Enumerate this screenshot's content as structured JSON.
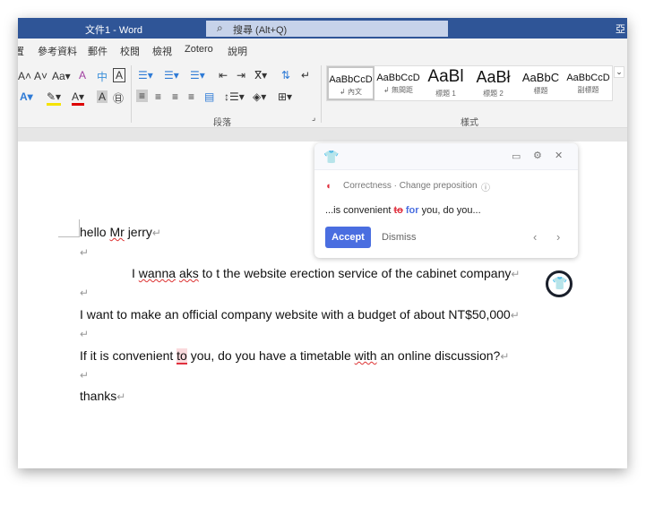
{
  "titlebar": {
    "title": "文件1  -  Word",
    "search_placeholder": "搜尋 (Alt+Q)",
    "right_char": "亞"
  },
  "menu": [
    "置",
    "參考資料",
    "郵件",
    "校閱",
    "檢視",
    "Zotero",
    "說明"
  ],
  "ribbon": {
    "paragraph_group": "段落",
    "styles_group": "樣式",
    "styles": [
      {
        "preview": "AaBbCcD",
        "label": "↲ 內文"
      },
      {
        "preview": "AaBbCcD",
        "label": "↲ 無間距"
      },
      {
        "preview": "AaBl",
        "label": "標題 1"
      },
      {
        "preview": "AaBł",
        "label": "標題 2"
      },
      {
        "preview": "AaBbC",
        "label": "標題"
      },
      {
        "preview": "AaBbCcD",
        "label": "副標題"
      }
    ]
  },
  "document": {
    "line1a": "hello ",
    "line1b": "Mr",
    "line1c": " ",
    "line1d": "jerry",
    "line2a": "I ",
    "line2b": "wanna",
    "line2c": " ",
    "line2d": "aks",
    "line2e": " to t the website erection service of the cabinet company",
    "line3": "I want to make an official company website with a budget of about NT$50,000",
    "line4a": "If it is convenient ",
    "line4b": "to",
    "line4c": " you, do you have a timetable ",
    "line4d": "with",
    "line4e": " an online discussion?",
    "line5": "thanks",
    "pilcrow": "↵"
  },
  "grammarly": {
    "category": "Correctness · Change preposition",
    "snippet_pre": "...is convenient ",
    "removed": "to",
    "added": "for",
    "snippet_post": " you, do you...",
    "accept": "Accept",
    "dismiss": "Dismiss",
    "brand_color": "#15c39a",
    "accept_color": "#4a6ee0"
  }
}
